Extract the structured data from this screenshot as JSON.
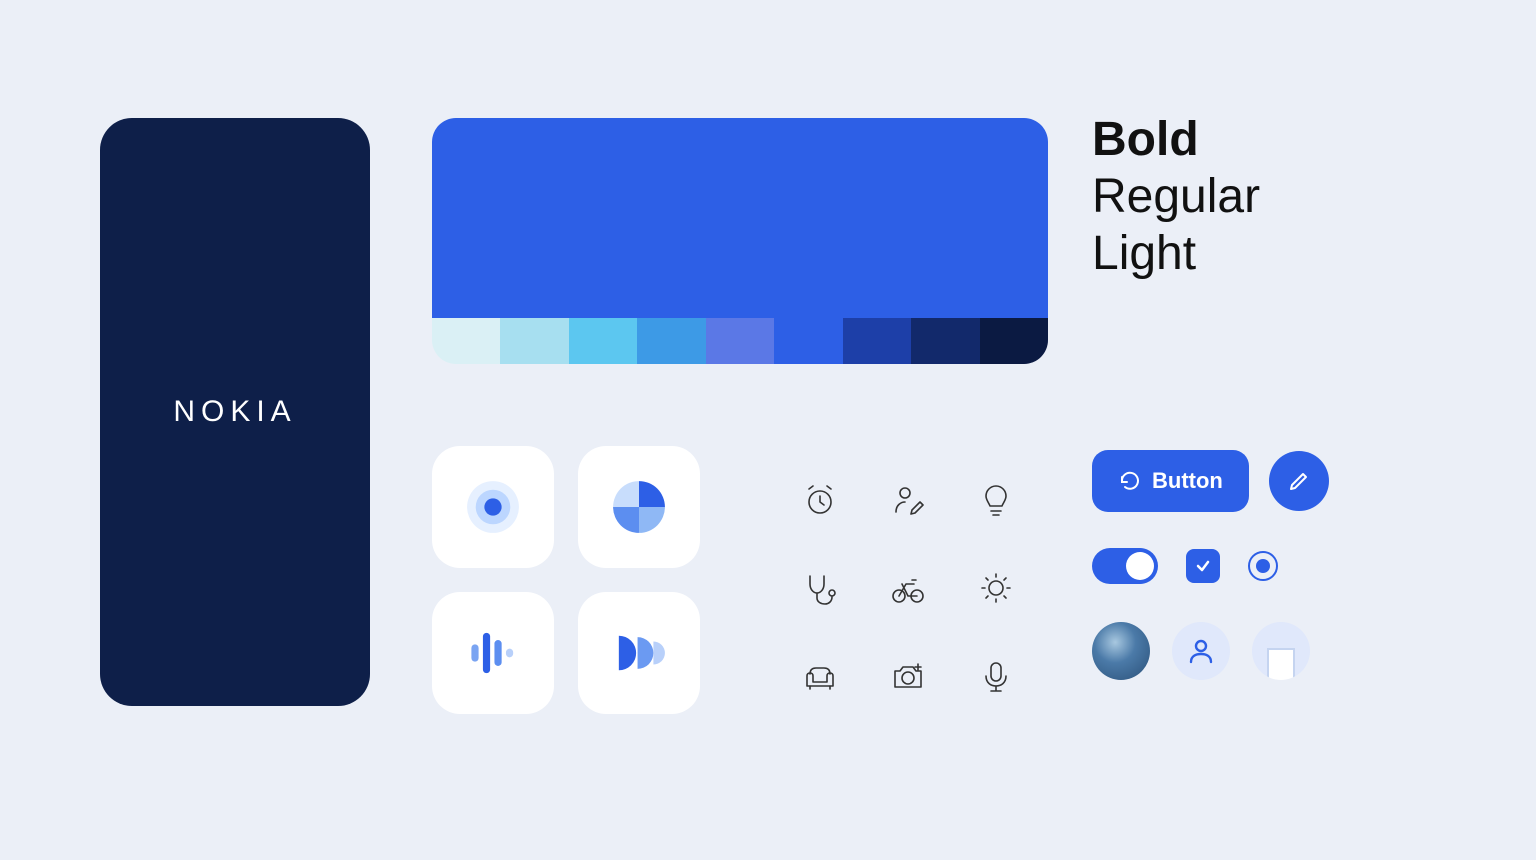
{
  "brand": "NOKIA",
  "palette": {
    "primary": "#2d5fe6",
    "shades": [
      "#daf0f5",
      "#a7dff0",
      "#5cc7f0",
      "#3d9ae6",
      "#5b78e6",
      "#2d5fe6",
      "#1d3fa8",
      "#12296b",
      "#0b1a42"
    ]
  },
  "typography": {
    "bold": "Bold",
    "regular": "Regular",
    "light": "Light"
  },
  "app_tiles": [
    "target",
    "pinwheel",
    "audio-bars",
    "semicircles"
  ],
  "outline_icons": [
    "alarm-clock",
    "user-edit",
    "lightbulb",
    "stethoscope",
    "bicycle",
    "sun",
    "sofa",
    "camera-plus",
    "microphone"
  ],
  "controls": {
    "button_label": "Button"
  }
}
